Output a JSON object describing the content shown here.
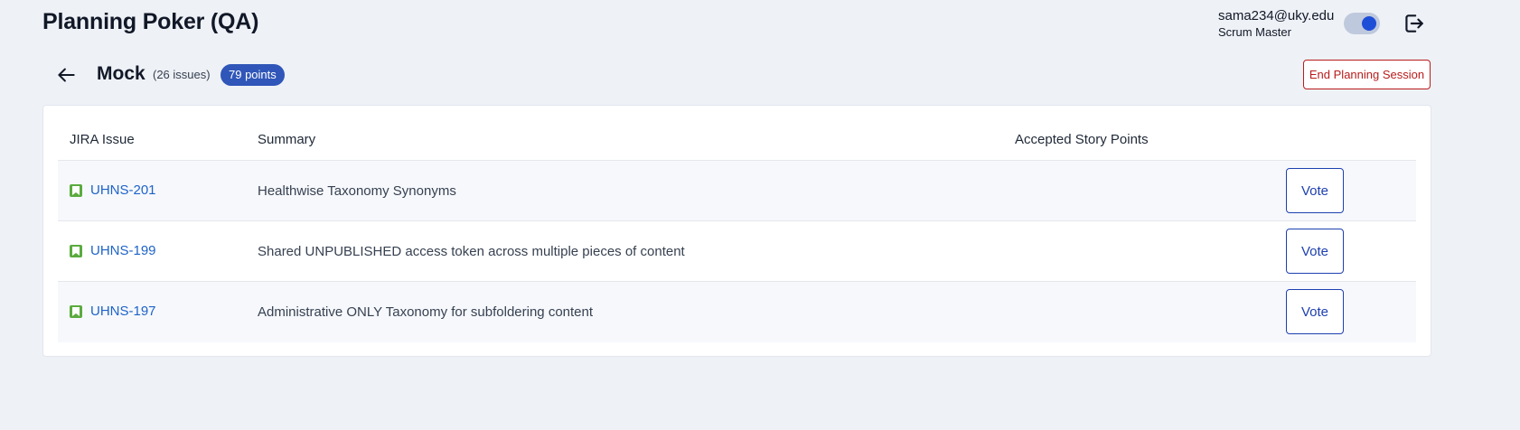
{
  "header": {
    "title": "Planning Poker (QA)",
    "user_email": "sama234@uky.edu",
    "user_role": "Scrum Master",
    "theme_toggle_icon": "toggle-switch-on",
    "logout_icon": "logout-icon"
  },
  "session": {
    "back_icon": "arrow-left-icon",
    "name": "Mock",
    "issue_count": "(26 issues)",
    "points_badge": "79 points",
    "end_button_label": "End Planning Session"
  },
  "table": {
    "columns": [
      "JIRA Issue",
      "Summary",
      "Accepted Story Points"
    ],
    "rows": [
      {
        "key": "UHNS-201",
        "summary": "Healthwise Taxonomy Synonyms",
        "points": "",
        "action": "Vote"
      },
      {
        "key": "UHNS-199",
        "summary": "Shared UNPUBLISHED access token across multiple pieces of content",
        "points": "",
        "action": "Vote"
      },
      {
        "key": "UHNS-197",
        "summary": "Administrative ONLY Taxonomy for subfoldering content",
        "points": "",
        "action": "Vote"
      }
    ]
  },
  "colors": {
    "accent": "#1d4ed8",
    "badge": "#2f56b8",
    "danger": "#b91c1c",
    "issue_type_story": "#5aab3e",
    "link": "#1e63c8"
  }
}
